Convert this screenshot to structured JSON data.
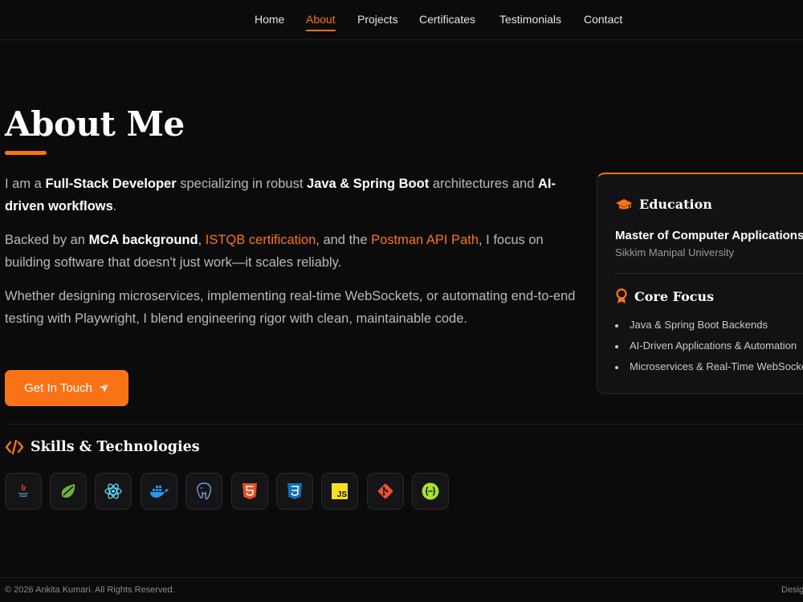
{
  "nav": {
    "items": [
      {
        "label": "Home"
      },
      {
        "label": "About",
        "active": true
      },
      {
        "label": "Projects"
      },
      {
        "label": "Certificates"
      },
      {
        "label": "Testimonials"
      },
      {
        "label": "Contact"
      }
    ]
  },
  "about": {
    "title": "About Me",
    "p1": {
      "t1": "I am a ",
      "b1": "Full-Stack Developer",
      "t2": " specializing in robust ",
      "b2": "Java & Spring Boot",
      "t3": " architectures and ",
      "b3": "AI-driven workflows",
      "t4": "."
    },
    "p2": {
      "t1": "Backed by an ",
      "b1": "MCA background",
      "t2": ", ",
      "a1": "ISTQB certification",
      "t3": ", and the ",
      "a2": "Postman API Path",
      "t4": ", I focus on building software that doesn't just work—it scales reliably."
    },
    "p3": "Whether designing microservices, implementing real-time WebSockets, or automating end-to-end testing with Playwright, I blend engineering rigor with clean, maintainable code.",
    "cta_label": "Get In Touch",
    "cta_icon": "paper-plane-icon"
  },
  "skills": {
    "title": "Skills & Technologies",
    "title_icon": "code-icon",
    "items": [
      {
        "icon": "java-icon"
      },
      {
        "icon": "spring-icon"
      },
      {
        "icon": "react-icon"
      },
      {
        "icon": "docker-icon"
      },
      {
        "icon": "postgresql-icon"
      },
      {
        "icon": "html5-icon"
      },
      {
        "icon": "css3-icon"
      },
      {
        "icon": "javascript-icon",
        "text": "JS"
      },
      {
        "icon": "git-icon"
      },
      {
        "icon": "json-icon"
      }
    ]
  },
  "card": {
    "education_title": "Education",
    "education_icon": "graduation-cap-icon",
    "degree": "Master of Computer Applications",
    "university": "Sikkim Manipal University",
    "core_title": "Core Focus",
    "core_icon": "award-icon",
    "core_items": [
      "Java & Spring Boot Backends",
      "AI-Driven Applications & Automation",
      "Microservices & Real-Time WebSockets"
    ]
  },
  "footer": {
    "copyright": "© 2026 Ankita Kumari. All Rights Reserved.",
    "right": "Designed"
  },
  "colors": {
    "accent": "#f97316",
    "background": "#0b0b0c",
    "card": "#121214"
  }
}
